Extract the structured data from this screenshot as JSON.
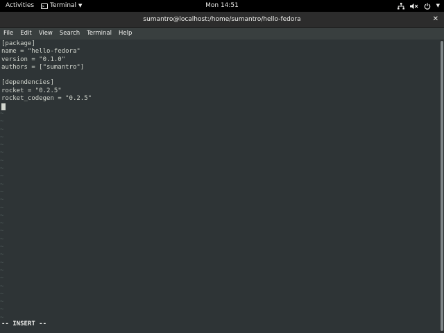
{
  "topbar": {
    "activities": "Activities",
    "app_menu": "Terminal",
    "app_menu_icon": ">_",
    "clock": "Mon 14:51",
    "tray_icons": [
      "network-icon",
      "volume-muted-icon",
      "power-icon"
    ]
  },
  "window": {
    "title": "sumantro@localhost:/home/sumantro/hello-fedora",
    "close": "✕"
  },
  "menubar": {
    "file": "File",
    "edit": "Edit",
    "view": "View",
    "search": "Search",
    "terminal": "Terminal",
    "help": "Help"
  },
  "editor": {
    "lines": [
      "[package]",
      "name = \"hello-fedora\"",
      "version = \"0.1.0\"",
      "authors = [\"sumantro\"]",
      "",
      "[dependencies]",
      "rocket = \"0.2.5\"",
      "rocket_codegen = \"0.2.5\""
    ],
    "tilde": "~",
    "mode": "-- INSERT --"
  },
  "colors": {
    "terminal_bg": "#2e3436",
    "text": "#d3d7cf",
    "tilde": "#4e5a5a",
    "titlebar": "#2c2c2c",
    "menubar": "#393f3f"
  }
}
